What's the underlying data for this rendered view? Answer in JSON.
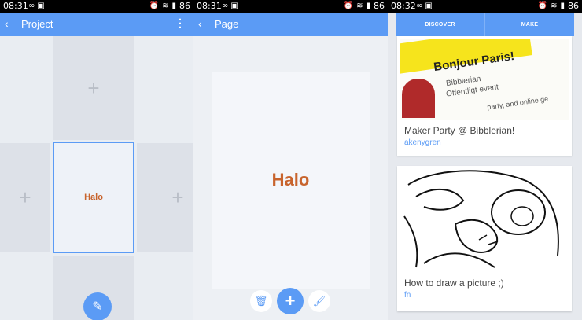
{
  "panels": [
    {
      "status": {
        "time": "08:31",
        "battery": "86"
      },
      "appbar": {
        "title": "Project"
      },
      "tile_label": "Halo"
    },
    {
      "status": {
        "time": "08:31",
        "battery": "86"
      },
      "appbar": {
        "title": "Page"
      },
      "page_label": "Halo"
    },
    {
      "status": {
        "time": "08:32",
        "battery": "86"
      },
      "tabs": [
        "DISCOVER",
        "MAKE"
      ],
      "cards": [
        {
          "caption": "Maker Party @ Bibblerian!",
          "author": "akenygren",
          "poster_lines": [
            "Bonjour Paris!",
            "Bibblerian",
            "Offentligt event",
            "party, and online ge"
          ]
        },
        {
          "caption": "How to draw a picture ;)",
          "author": "fn"
        }
      ]
    }
  ],
  "icons": {
    "back": "chevron-left-icon",
    "menu": "overflow-menu-icon",
    "add_placeholder": "plus-icon",
    "edit": "pencil-icon",
    "delete": "trash-icon",
    "add": "plus-icon",
    "style": "brush-icon"
  },
  "colors": {
    "accent": "#5b9bf5",
    "halo_text": "#c8642d",
    "background": "#e9edf2"
  }
}
